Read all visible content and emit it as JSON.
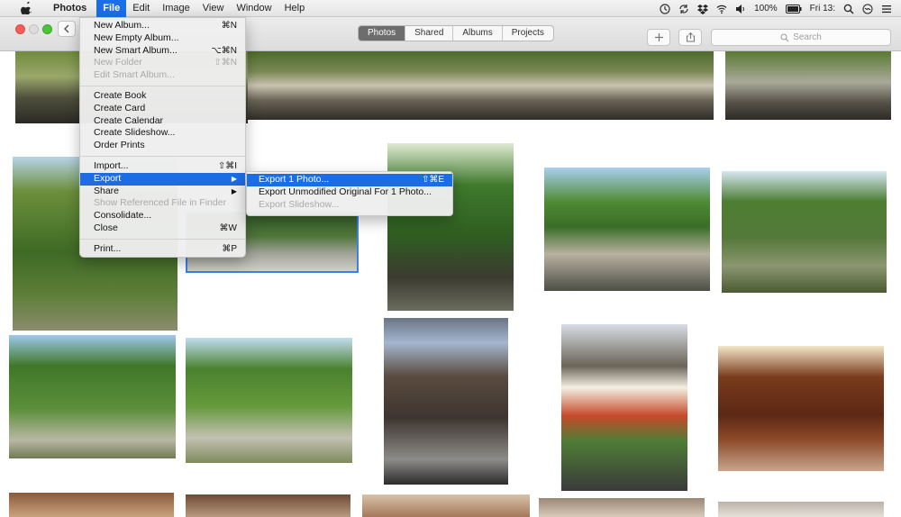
{
  "menubar": {
    "app_name": "Photos",
    "menus": [
      "File",
      "Edit",
      "Image",
      "View",
      "Window",
      "Help"
    ],
    "battery": "100%",
    "clock": "Fri 13:"
  },
  "toolbar": {
    "segments": [
      "Photos",
      "Shared",
      "Albums",
      "Projects"
    ],
    "selected_segment": "Photos",
    "search_placeholder": "Search"
  },
  "file_menu": {
    "group1": [
      {
        "label": "New Album...",
        "shortcut": "⌘N",
        "enabled": true
      },
      {
        "label": "New Empty Album...",
        "shortcut": "",
        "enabled": true
      },
      {
        "label": "New Smart Album...",
        "shortcut": "⌥⌘N",
        "enabled": true
      },
      {
        "label": "New Folder",
        "shortcut": "⇧⌘N",
        "enabled": false
      },
      {
        "label": "Edit Smart Album...",
        "shortcut": "",
        "enabled": false
      }
    ],
    "group2": [
      {
        "label": "Create Book",
        "enabled": true
      },
      {
        "label": "Create Card",
        "enabled": true
      },
      {
        "label": "Create Calendar",
        "enabled": true
      },
      {
        "label": "Create Slideshow...",
        "enabled": true
      },
      {
        "label": "Order Prints",
        "enabled": true
      }
    ],
    "group3": [
      {
        "label": "Import...",
        "shortcut": "⇧⌘I",
        "enabled": true
      },
      {
        "label": "Export",
        "shortcut": "",
        "enabled": true,
        "highlighted": true
      },
      {
        "label": "Share",
        "shortcut": "",
        "enabled": true
      },
      {
        "label": "Show Referenced File in Finder",
        "shortcut": "",
        "enabled": false
      },
      {
        "label": "Consolidate...",
        "shortcut": "",
        "enabled": true
      },
      {
        "label": "Close",
        "shortcut": "⌘W",
        "enabled": true
      }
    ],
    "group4": [
      {
        "label": "Print...",
        "shortcut": "⌘P",
        "enabled": true
      }
    ]
  },
  "export_submenu": [
    {
      "label": "Export 1 Photo...",
      "shortcut": "⇧⌘E",
      "enabled": true,
      "highlighted": true
    },
    {
      "label": "Export Unmodified Original For 1 Photo...",
      "shortcut": "",
      "enabled": true
    },
    {
      "label": "Export Slideshow...",
      "shortcut": "",
      "enabled": false
    }
  ],
  "colors": {
    "menu_highlight": "#1c6ce4",
    "selection_outline": "#3d7ef0",
    "segment_selected": "#6d6d6d"
  }
}
